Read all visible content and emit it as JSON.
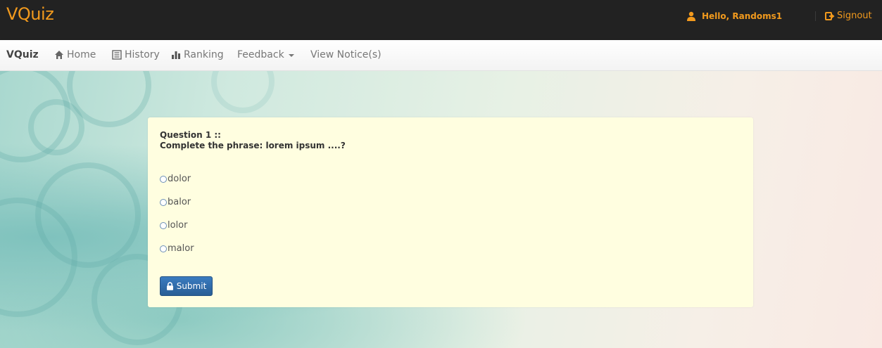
{
  "header": {
    "logo": "VQuiz",
    "greeting": "Hello,  Randoms1",
    "signout_label": "Signout",
    "accent_color": "#f29a1d"
  },
  "navbar": {
    "brand": "VQuiz",
    "items": [
      {
        "label": "Home",
        "icon": "home-icon"
      },
      {
        "label": "History",
        "icon": "list-icon"
      },
      {
        "label": "Ranking",
        "icon": "bar-chart-icon"
      },
      {
        "label": "Feedback",
        "icon": "caret-down-icon"
      },
      {
        "label": "View Notice(s)",
        "icon": ""
      }
    ]
  },
  "quiz": {
    "question_number": "Question  1 ::",
    "question_text": "Complete the phrase: lorem ipsum ....?",
    "options": [
      "dolor",
      "balor",
      "lolor",
      "malor"
    ],
    "submit_label": "Submit"
  }
}
